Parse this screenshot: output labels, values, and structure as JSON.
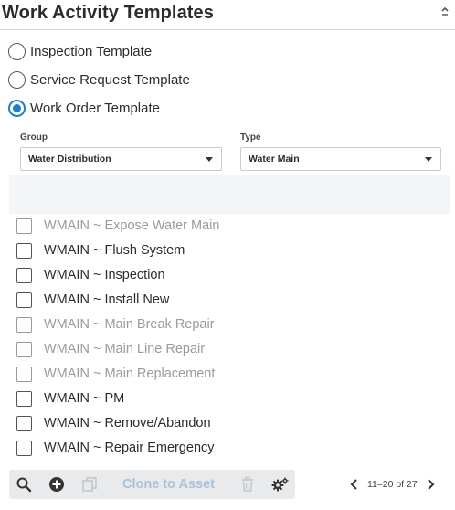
{
  "header": {
    "title": "Work Activity Templates",
    "collapse_icon": "chevron-up-icon"
  },
  "template_types": [
    {
      "label": "Inspection Template",
      "selected": false
    },
    {
      "label": "Service Request Template",
      "selected": false
    },
    {
      "label": "Work Order Template",
      "selected": true
    }
  ],
  "filters": {
    "group": {
      "label": "Group",
      "value": "Water Distribution"
    },
    "type": {
      "label": "Type",
      "value": "Water Main"
    }
  },
  "templates": [
    {
      "label": "WMAIN ~ Expose Water Main",
      "enabled": false,
      "checked": false
    },
    {
      "label": "WMAIN ~ Flush System",
      "enabled": true,
      "checked": false
    },
    {
      "label": "WMAIN ~ Inspection",
      "enabled": true,
      "checked": false
    },
    {
      "label": "WMAIN ~ Install New",
      "enabled": true,
      "checked": false
    },
    {
      "label": "WMAIN ~ Main Break Repair",
      "enabled": false,
      "checked": false
    },
    {
      "label": "WMAIN ~ Main Line Repair",
      "enabled": false,
      "checked": false
    },
    {
      "label": "WMAIN ~ Main Replacement",
      "enabled": false,
      "checked": false
    },
    {
      "label": "WMAIN ~ PM",
      "enabled": true,
      "checked": false
    },
    {
      "label": "WMAIN ~ Remove/Abandon",
      "enabled": true,
      "checked": false
    },
    {
      "label": "WMAIN ~ Repair Emergency",
      "enabled": true,
      "checked": false
    }
  ],
  "toolbar": {
    "icons": [
      "search-icon",
      "add-icon",
      "copy-icon",
      "delete-icon",
      "settings-icon"
    ],
    "clone_label": "Clone to Asset"
  },
  "pager": {
    "range_text": "11–20 of 27"
  },
  "colors": {
    "accent": "#1a7fd0",
    "disabled_text": "#9a9a9a",
    "toolbar_bg": "#e8eaec",
    "clone_disabled": "#a9c3dc"
  }
}
